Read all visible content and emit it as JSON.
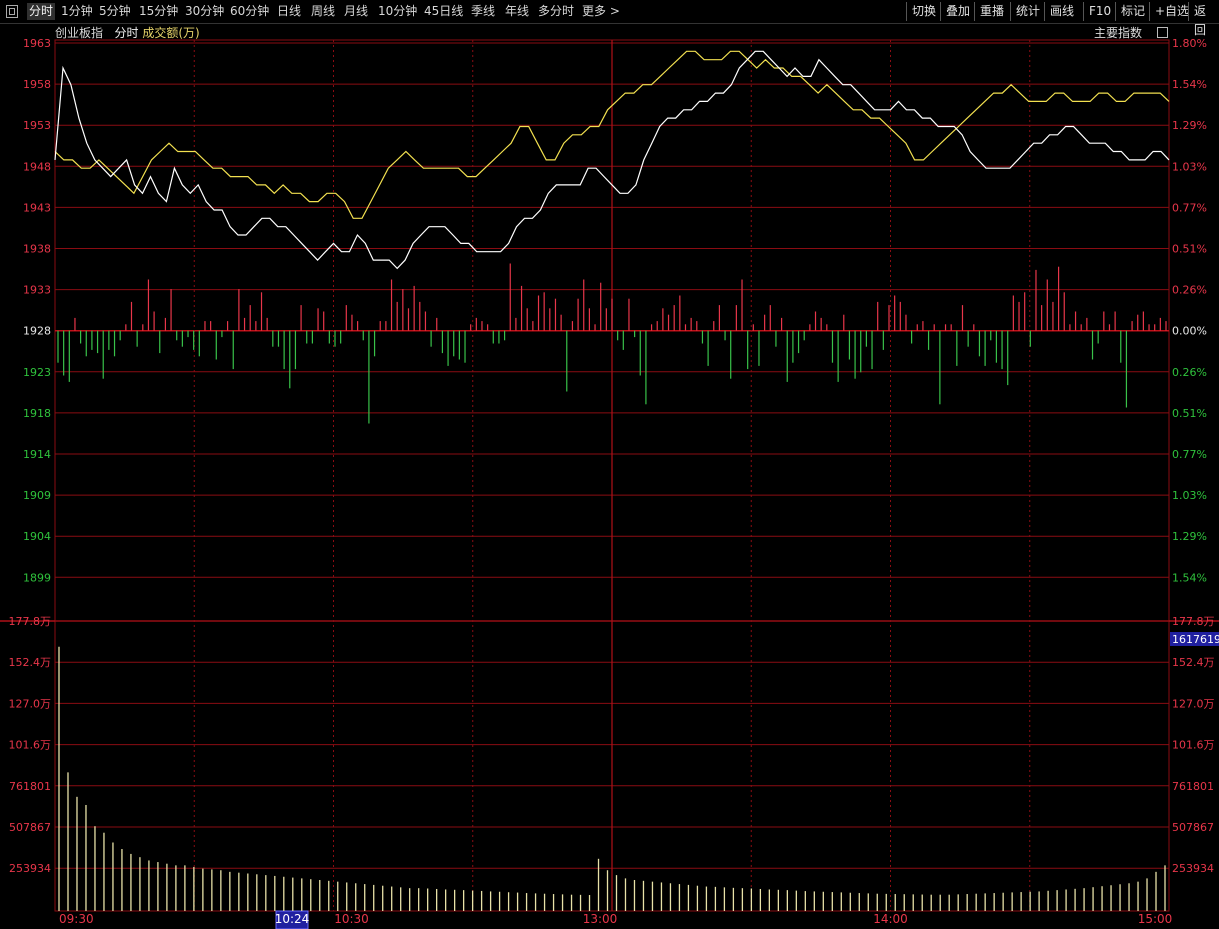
{
  "toolbar": {
    "periods": [
      "分时",
      "1分钟",
      "5分钟",
      "15分钟",
      "30分钟",
      "60分钟",
      "日线",
      "周线",
      "月线",
      "10分钟",
      "45日线",
      "季线",
      "年线",
      "多分时",
      "更多 >"
    ],
    "actions": [
      "切换",
      "叠加",
      "重播",
      "统计",
      "画线",
      "F10",
      "标记",
      "+自选",
      "返回"
    ]
  },
  "subheader": {
    "index_name": "创业板指",
    "mode": "分时",
    "indicator": "成交额(万)",
    "right_button": "主要指数"
  },
  "colors": {
    "up": "#e8364a",
    "down": "#39c24a",
    "grid": "#8a0c12",
    "price_line": "#ffffff",
    "avg_line": "#f2e050",
    "volume_bar": "#e8e2a8",
    "axis_text_red": "#e8364a",
    "axis_text_green": "#2fc23c",
    "cursor_time_bg": "#2020a0"
  },
  "chart_data": [
    {
      "type": "line",
      "title": "",
      "x_times": [
        "09:30",
        "10:30",
        "13:00",
        "14:00",
        "15:00"
      ],
      "y_left_ticks": [
        "1963",
        "1958",
        "1953",
        "1948",
        "1943",
        "1938",
        "1933",
        "1928",
        "1923",
        "1918",
        "1914",
        "1909",
        "1904",
        "1899"
      ],
      "y_right_ticks": [
        "1.80%",
        "1.54%",
        "1.29%",
        "1.03%",
        "0.77%",
        "0.51%",
        "0.26%",
        "0.00%",
        "0.26%",
        "0.51%",
        "0.77%",
        "1.03%",
        "1.29%",
        "1.54%"
      ],
      "ylim": [
        1897,
        1964
      ],
      "prev_close": 1928,
      "series": [
        {
          "values": [
            1949,
            1960,
            1958,
            1954,
            1951,
            1949,
            1948,
            1947,
            1948,
            1949,
            1946,
            1945,
            1947,
            1945,
            1944,
            1948,
            1946,
            1945,
            1946,
            1944,
            1943,
            1943,
            1941,
            1940,
            1940,
            1941,
            1942,
            1942,
            1941,
            1941,
            1940,
            1939,
            1938,
            1937,
            1938,
            1939,
            1938,
            1938,
            1940,
            1939,
            1937,
            1937,
            1937,
            1936,
            1937,
            1939,
            1940,
            1941,
            1941,
            1941,
            1940,
            1939,
            1939,
            1938,
            1938,
            1938,
            1938,
            1939,
            1941,
            1942,
            1942,
            1943,
            1945,
            1946,
            1946,
            1946,
            1946,
            1948,
            1948,
            1947,
            1946,
            1945,
            1945,
            1946,
            1949,
            1951,
            1953,
            1954,
            1954,
            1955,
            1955,
            1956,
            1956,
            1957,
            1957,
            1958,
            1960,
            1961,
            1962,
            1962,
            1961,
            1960,
            1959,
            1960,
            1959,
            1959,
            1961,
            1960,
            1959,
            1958,
            1958,
            1957,
            1956,
            1955,
            1955,
            1955,
            1956,
            1955,
            1955,
            1954,
            1954,
            1953,
            1953,
            1953,
            1952,
            1950,
            1949,
            1948,
            1948,
            1948,
            1948,
            1949,
            1950,
            1951,
            1951,
            1952,
            1952,
            1953,
            1953,
            1952,
            1951,
            1951,
            1951,
            1950,
            1950,
            1949,
            1949,
            1949,
            1950,
            1950,
            1949
          ],
          "label": ""
        },
        {
          "values": [
            1950,
            1949,
            1949,
            1948,
            1948,
            1949,
            1948,
            1947,
            1946,
            1945,
            1947,
            1949,
            1950,
            1951,
            1950,
            1950,
            1950,
            1949,
            1948,
            1948,
            1947,
            1947,
            1947,
            1946,
            1946,
            1945,
            1946,
            1945,
            1945,
            1944,
            1944,
            1945,
            1945,
            1944,
            1942,
            1942,
            1944,
            1946,
            1948,
            1949,
            1950,
            1949,
            1948,
            1948,
            1948,
            1948,
            1948,
            1947,
            1947,
            1948,
            1949,
            1950,
            1951,
            1953,
            1953,
            1951,
            1949,
            1949,
            1951,
            1952,
            1952,
            1953,
            1953,
            1955,
            1956,
            1957,
            1957,
            1958,
            1958,
            1959,
            1960,
            1961,
            1962,
            1962,
            1961,
            1961,
            1961,
            1962,
            1962,
            1961,
            1960,
            1961,
            1960,
            1960,
            1959,
            1959,
            1958,
            1957,
            1958,
            1957,
            1956,
            1955,
            1955,
            1954,
            1954,
            1953,
            1952,
            1951,
            1949,
            1949,
            1950,
            1951,
            1952,
            1953,
            1954,
            1955,
            1956,
            1957,
            1957,
            1958,
            1957,
            1956,
            1956,
            1956,
            1957,
            1957,
            1956,
            1956,
            1956,
            1957,
            1957,
            1956,
            1956,
            1957,
            1957,
            1957,
            1957,
            1956
          ],
          "label": ""
        }
      ]
    },
    {
      "type": "bar",
      "title": "",
      "y_left_ticks": [
        "177.8万",
        "152.4万",
        "127.0万",
        "101.6万",
        "761801",
        "507867",
        "253934"
      ],
      "y_right_ticks": [
        "177.8万",
        "152.4万",
        "127.0万",
        "101.6万",
        "761801",
        "507867",
        "253934"
      ],
      "current_value_label": "1617619",
      "cursor_time_label": "10:24",
      "ylim": [
        0,
        1778000
      ],
      "values": [
        1620000,
        850000,
        700000,
        650000,
        520000,
        480000,
        420000,
        380000,
        350000,
        330000,
        310000,
        300000,
        290000,
        280000,
        280000,
        270000,
        260000,
        255000,
        250000,
        240000,
        235000,
        230000,
        225000,
        220000,
        215000,
        210000,
        205000,
        200000,
        195000,
        190000,
        185000,
        180000,
        175000,
        170000,
        165000,
        160000,
        155000,
        150000,
        145000,
        140000,
        140000,
        138000,
        135000,
        132000,
        130000,
        128000,
        125000,
        123000,
        120000,
        118000,
        115000,
        113000,
        110000,
        108000,
        106000,
        104000,
        102000,
        100000,
        99000,
        98000,
        320000,
        250000,
        220000,
        200000,
        190000,
        185000,
        180000,
        175000,
        170000,
        165000,
        160000,
        155000,
        150000,
        148000,
        145000,
        142000,
        140000,
        138000,
        135000,
        132000,
        130000,
        128000,
        125000,
        122000,
        120000,
        118000,
        116000,
        114000,
        112000,
        110000,
        108000,
        106000,
        105000,
        104000,
        103000,
        102000,
        101000,
        100000,
        100000,
        100000,
        102000,
        104000,
        106000,
        108000,
        110000,
        112000,
        114000,
        116000,
        118000,
        120000,
        124000,
        128000,
        132000,
        136000,
        140000,
        146000,
        152000,
        158000,
        164000,
        170000,
        180000,
        200000,
        240000,
        280000
      ]
    },
    {
      "type": "bar",
      "title": "",
      "values": [
        -1.0,
        -1.4,
        -1.6,
        0.4,
        -0.4,
        -0.8,
        -0.6,
        -0.7,
        -1.5,
        -0.6,
        -0.8,
        -0.3,
        0.2,
        0.9,
        -0.5,
        0.2,
        1.6,
        0.6,
        -0.7,
        0.4,
        1.3,
        -0.3,
        -0.5,
        -0.2,
        -0.6,
        -0.8,
        0.3,
        0.3,
        -0.9,
        -0.2,
        0.3,
        -1.2,
        1.3,
        0.4,
        0.8,
        0.3,
        1.2,
        0.4,
        -0.5,
        -0.5,
        -1.2,
        -1.8,
        -1.2,
        0.8,
        -0.4,
        -0.4,
        0.7,
        0.6,
        -0.4,
        -0.5,
        -0.4,
        0.8,
        0.5,
        0.3,
        -0.3,
        -2.9,
        -0.8,
        0.3,
        0.3,
        1.6,
        0.9,
        1.3,
        0.7,
        1.4,
        0.9,
        0.6,
        -0.5,
        0.4,
        -0.7,
        -1.1,
        -0.8,
        -0.9,
        -1.0,
        0.2,
        0.4,
        0.3,
        0.2,
        -0.4,
        -0.4,
        -0.3,
        2.1,
        0.4,
        1.4,
        0.7,
        0.3,
        1.1,
        1.2,
        0.7,
        1.0,
        0.5,
        -1.9,
        0.3,
        1.0,
        1.6,
        0.7,
        0.2,
        1.5,
        0.7,
        1.0,
        -0.3,
        -0.6,
        1.0,
        -0.2,
        -1.4,
        -2.3,
        0.2,
        0.3,
        0.7,
        0.5,
        0.8,
        1.1,
        0.2,
        0.4,
        0.3,
        -0.4,
        -1.1,
        0.3,
        0.8,
        -0.3,
        -1.5,
        0.8,
        1.6,
        -1.2,
        0.2,
        -1.1,
        0.5,
        0.8,
        -0.5,
        0.4,
        -1.6,
        -1.0,
        -0.7,
        -0.3,
        0.2,
        0.6,
        0.4,
        0.2,
        -1.0,
        -1.6,
        0.5,
        -0.9,
        -1.5,
        -1.3,
        -0.5,
        -1.2,
        0.9,
        -0.6,
        0.8,
        1.1,
        0.9,
        0.5,
        -0.4,
        0.2,
        0.3,
        -0.6,
        0.2,
        -2.3,
        0.2,
        0.2,
        -1.1,
        0.8,
        -0.5,
        0.2,
        -0.8,
        -1.1,
        -0.3,
        -1.0,
        -1.2,
        -1.7,
        1.1,
        0.9,
        1.2,
        -0.5,
        1.9,
        0.8,
        1.6,
        0.9,
        2.0,
        1.2,
        0.2,
        0.6,
        0.2,
        0.4,
        -0.9,
        -0.4,
        0.6,
        0.2,
        0.6,
        -1.0,
        -2.4,
        0.3,
        0.5,
        0.6,
        0.2,
        0.2,
        0.4,
        0.3
      ]
    }
  ]
}
